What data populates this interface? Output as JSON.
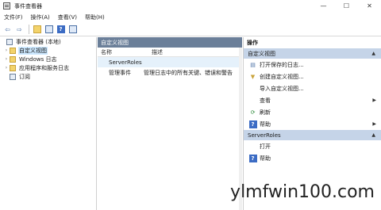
{
  "window": {
    "title": "事件查看器"
  },
  "window_controls": {
    "minimize": "—",
    "maximize": "☐",
    "close": "✕"
  },
  "menu": [
    "文件(F)",
    "操作(A)",
    "查看(V)",
    "帮助(H)"
  ],
  "toolbar": {
    "back": "⇦",
    "forward": "⇨",
    "help": "?"
  },
  "tree": [
    {
      "label": "事件查看器 (本地)",
      "expander": "",
      "selected": false
    },
    {
      "label": "自定义视图",
      "expander": "›",
      "selected": true
    },
    {
      "label": "Windows 日志",
      "expander": "›",
      "selected": false
    },
    {
      "label": "应用程序和服务日志",
      "expander": "›",
      "selected": false
    },
    {
      "label": "订阅",
      "expander": "",
      "selected": false
    }
  ],
  "center": {
    "header": "自定义视图",
    "columns": {
      "name": "名称",
      "description": "描述"
    },
    "rows": [
      {
        "name": "ServerRoles",
        "description": ""
      },
      {
        "name": "管理事件",
        "description": "管理日志中的所有关键、错误和警告"
      }
    ]
  },
  "actions": {
    "title": "操作",
    "sections": [
      {
        "header": "自定义视图",
        "items": [
          {
            "label": "打开保存的日志...",
            "icon": "open-log-icon",
            "glyph": "▤",
            "submenu": false
          },
          {
            "label": "创建自定义视图...",
            "icon": "filter-icon",
            "glyph": "▼",
            "submenu": false
          },
          {
            "label": "导入自定义视图...",
            "icon": "",
            "glyph": "",
            "submenu": false
          },
          {
            "label": "查看",
            "icon": "",
            "glyph": "",
            "submenu": true
          },
          {
            "label": "刷新",
            "icon": "refresh-icon",
            "glyph": "⟳",
            "submenu": false
          },
          {
            "label": "帮助",
            "icon": "help-icon",
            "glyph": "?",
            "submenu": true
          }
        ]
      },
      {
        "header": "ServerRoles",
        "items": [
          {
            "label": "打开",
            "icon": "",
            "glyph": "",
            "submenu": false
          },
          {
            "label": "帮助",
            "icon": "help-icon",
            "glyph": "?",
            "submenu": false
          }
        ]
      }
    ]
  },
  "watermark": "ylmfwin100.com",
  "colors": {
    "pane_header": "#6b7f99",
    "section_header": "#c5d4e8",
    "selection": "#cce8ff"
  }
}
